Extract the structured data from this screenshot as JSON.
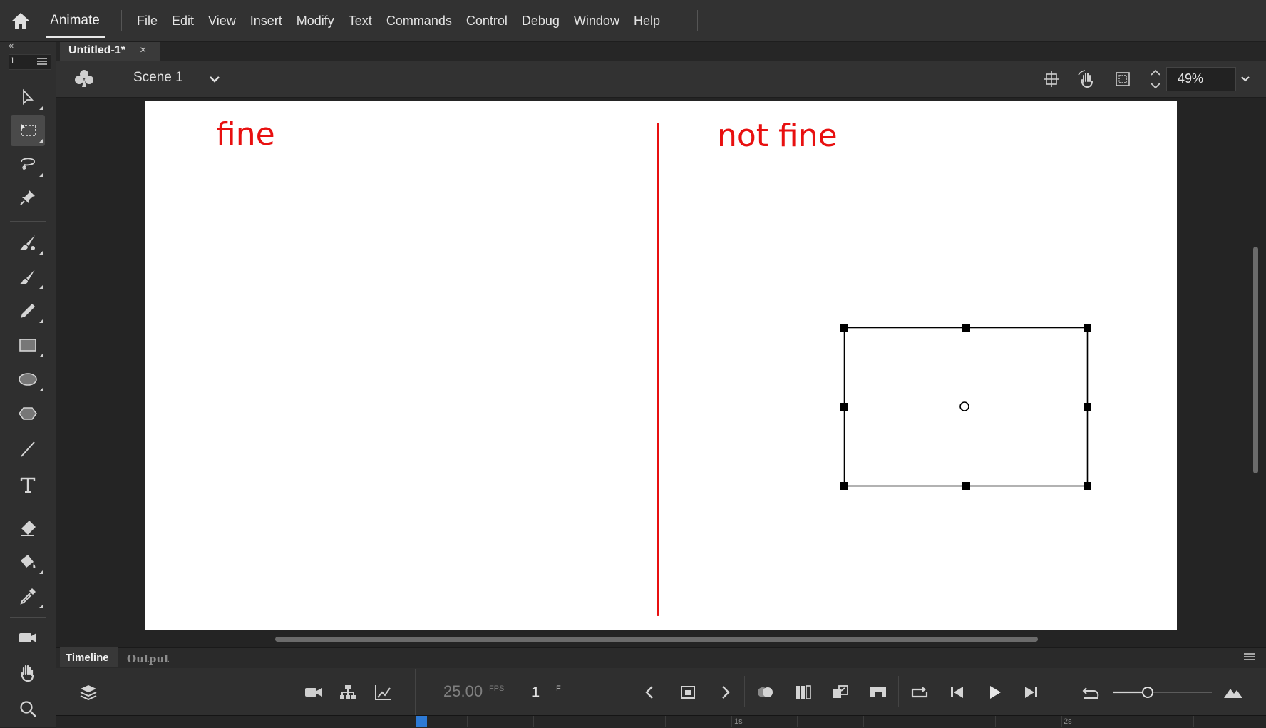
{
  "app": {
    "name": "Animate",
    "menus": [
      "File",
      "Edit",
      "View",
      "Insert",
      "Modify",
      "Text",
      "Commands",
      "Control",
      "Debug",
      "Window",
      "Help"
    ]
  },
  "toolbar_mini": {
    "collapse_glyph": "«",
    "page_number": "1"
  },
  "document": {
    "tab_title": "Untitled-1*",
    "close_glyph": "×"
  },
  "scene": {
    "name": "Scene 1",
    "zoom": "49%"
  },
  "stage": {
    "text_left": "fine",
    "text_right": "not fine",
    "colors": {
      "stage_bg": "#ffffff",
      "annotation": "#e81010",
      "selection": "#000000"
    }
  },
  "timeline": {
    "tabs": [
      "Timeline",
      "Output"
    ],
    "fps": "25.00",
    "fps_unit": "FPS",
    "frame": "1",
    "frame_unit": "F",
    "ruler_labels": [
      "1s",
      "2s"
    ]
  },
  "icons": {
    "toolbar": [
      "selection-icon",
      "free-transform-icon",
      "lasso-icon",
      "pin-icon",
      "fluid-brush-icon",
      "paint-brush-icon",
      "pencil-icon",
      "rectangle-icon",
      "oval-icon",
      "polystar-icon",
      "line-icon",
      "text-icon",
      "eraser-icon",
      "paint-bucket-icon",
      "eyedropper-icon",
      "camera-icon",
      "hand-icon",
      "zoom-icon"
    ]
  }
}
